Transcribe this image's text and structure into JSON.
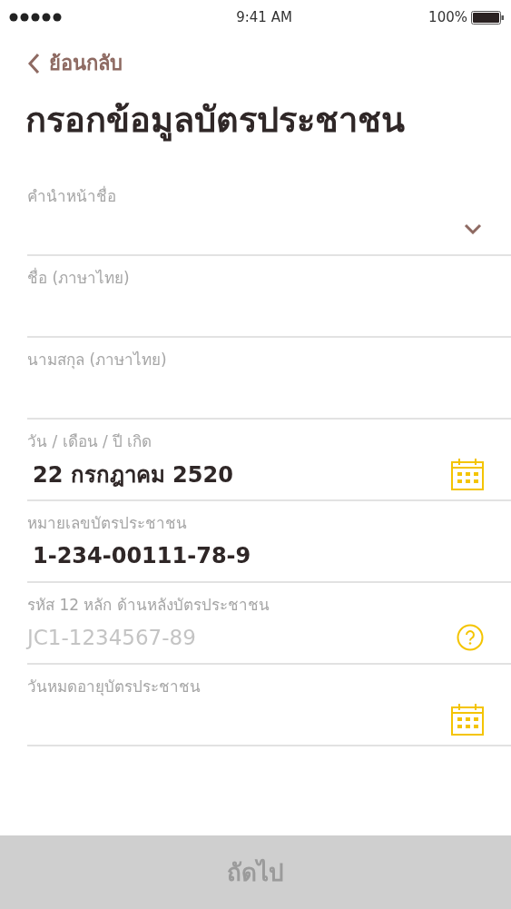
{
  "status_bar": {
    "time": "9:41 AM",
    "battery": "100%"
  },
  "back": {
    "label": "ย้อนกลับ"
  },
  "title": "กรอกข้อมูลบัตรประชาชน",
  "fields": [
    {
      "kind": "select",
      "label": "คำนำหน้าชื่อ"
    },
    {
      "kind": "text",
      "label": "ชื่อ (ภาษาไทย)"
    },
    {
      "kind": "text",
      "label": "นามสกุล (ภาษาไทย)"
    },
    {
      "kind": "date",
      "label": "วัน / เดือน / ปี เกิด",
      "value": "22 กรกฎาคม 2520"
    },
    {
      "kind": "text",
      "label": "หมายเลขบัตรประชาชน",
      "value": "1-234-00111-78-9"
    },
    {
      "kind": "help",
      "label": "รหัส 12 หลัก ด้านหลังบัตรประชาชน",
      "placeholder": "JC1-1234567-89"
    },
    {
      "kind": "date",
      "label": "วันหมดอายุบัตรประชาชน"
    }
  ],
  "next_button": {
    "label": "ถัดไป",
    "disabled": true
  }
}
